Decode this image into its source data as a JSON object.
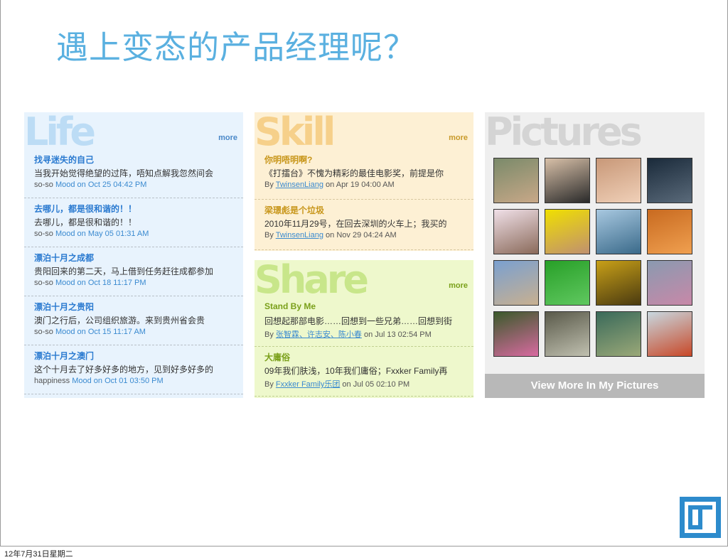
{
  "title": "遇上变态的产品经理呢？",
  "life": {
    "big": "Life",
    "more": "more",
    "entries": [
      {
        "title": "找寻迷失的自己",
        "body": "当我开始觉得绝望的过阵，唔知点解我忽然间会",
        "mood": "so-so",
        "meta": "Mood on Oct 25 04:42 PM"
      },
      {
        "title": "去哪儿，都是很和谐的！！",
        "body": "去哪儿，都是很和谐的！！",
        "mood": "so-so",
        "meta": "Mood on May 05 01:31 AM"
      },
      {
        "title": "漂泊十月之成都",
        "body": "贵阳回来的第二天，马上借到任务赶往成都参加",
        "mood": "so-so",
        "meta": "Mood on Oct 18 11:17 PM"
      },
      {
        "title": "漂泊十月之贵阳",
        "body": "澳门之行后，公司组织旅游。来到贵州省会贵",
        "mood": "so-so",
        "meta": "Mood on Oct 15 11:17 AM"
      },
      {
        "title": "漂泊十月之澳门",
        "body": "这个十月去了好多好多的地方，见到好多好多的",
        "mood": "happiness",
        "meta": "Mood on Oct 01 03:50 PM"
      }
    ]
  },
  "skill": {
    "big": "Skill",
    "more": "more",
    "entries": [
      {
        "title": "你明唔明啊?",
        "body": "《打擂台》不愧为精彩的最佳电影奖，前提是你",
        "by": "By",
        "author": "TwinsenLiang",
        "meta": "on Apr 19 04:00 AM"
      },
      {
        "title": "梁璟彪是个垃圾",
        "body": "2010年11月29号，在回去深圳的火车上；我买的",
        "by": "By",
        "author": "TwinsenLiang",
        "meta": "on Nov 29 04:24 AM"
      }
    ]
  },
  "share": {
    "big": "Share",
    "more": "more",
    "entries": [
      {
        "title": "Stand By Me",
        "body": "回想起那部电影……回想到一些兄弟……回想到街",
        "by": "By",
        "author": "张智霖、许志安、陈小春",
        "meta": "on Jul 13 02:54 PM"
      },
      {
        "title": "大庸俗",
        "body": "09年我们肤浅，10年我们庸俗；Fxxker Family再",
        "by": "By",
        "author": "Fxxker Family乐团",
        "meta": "on Jul 05 02:10 PM"
      }
    ]
  },
  "pictures": {
    "big": "Pictures",
    "view_more": "View More In My Pictures",
    "photos": [
      {
        "name": "photo-boy-face",
        "colors": [
          "#7a8a6a",
          "#c8a888"
        ]
      },
      {
        "name": "photo-sunglasses",
        "colors": [
          "#d8c0a8",
          "#2a2a2a"
        ]
      },
      {
        "name": "photo-girl-smile",
        "colors": [
          "#c89878",
          "#f0d0b8"
        ]
      },
      {
        "name": "photo-night-sea",
        "colors": [
          "#1a2a3a",
          "#5a6a7a"
        ]
      },
      {
        "name": "photo-island",
        "colors": [
          "#f0e0e8",
          "#8a6a5a"
        ]
      },
      {
        "name": "photo-yellow-eyes",
        "colors": [
          "#f0e000",
          "#c09070"
        ]
      },
      {
        "name": "photo-ocean",
        "colors": [
          "#a8c8e0",
          "#3a6a8a"
        ]
      },
      {
        "name": "photo-boy-portrait",
        "colors": [
          "#c86a20",
          "#f0a050"
        ]
      },
      {
        "name": "photo-ruins",
        "colors": [
          "#7aa0d0",
          "#c8b090"
        ]
      },
      {
        "name": "photo-green",
        "colors": [
          "#28a028",
          "#60c860"
        ]
      },
      {
        "name": "photo-yellow-tree",
        "colors": [
          "#c8a018",
          "#4a3a10"
        ]
      },
      {
        "name": "photo-crowd",
        "colors": [
          "#8a9ab0",
          "#c888a8"
        ]
      },
      {
        "name": "photo-party",
        "colors": [
          "#3a5a2a",
          "#d86aa0"
        ]
      },
      {
        "name": "photo-statue",
        "colors": [
          "#5a5a4a",
          "#c0c0b0"
        ]
      },
      {
        "name": "photo-city-aerial",
        "colors": [
          "#3a6a5a",
          "#9aa878"
        ]
      },
      {
        "name": "photo-beach",
        "colors": [
          "#c8d8e0",
          "#c84828"
        ]
      }
    ]
  },
  "footer": {
    "date": "12年7月31日星期二"
  }
}
